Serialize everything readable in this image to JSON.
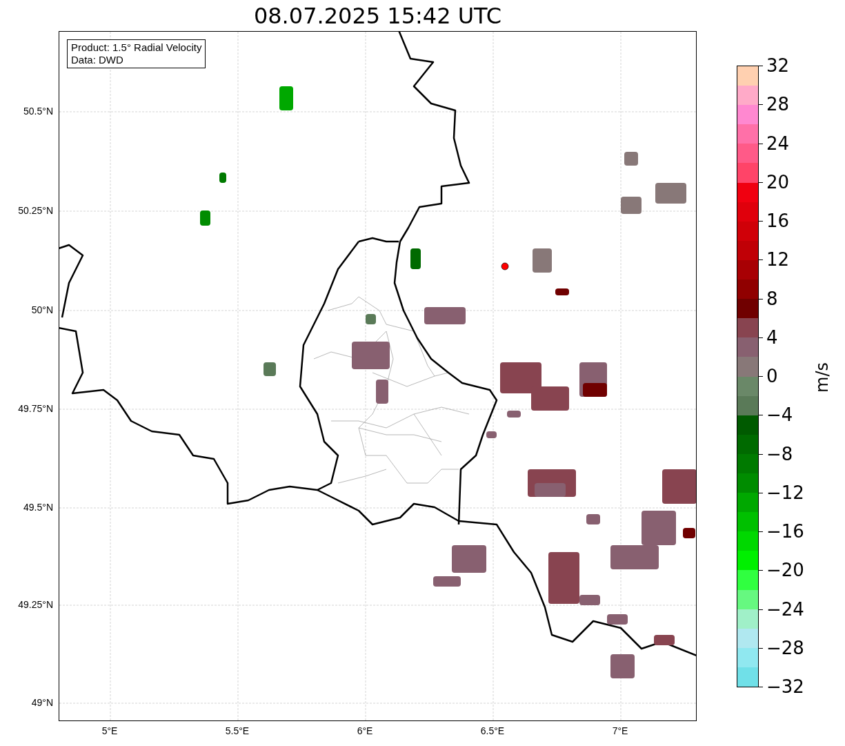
{
  "title": "08.07.2025 15:42 UTC",
  "map": {
    "info_box": [
      "Product: 1.5° Radial Velocity",
      "Data: DWD"
    ],
    "lat_ticks": [
      "50.5°N",
      "50.25°N",
      "50°N",
      "49.75°N",
      "49.5°N",
      "49.25°N",
      "49°N"
    ],
    "lon_ticks": [
      "5°E",
      "5.5°E",
      "6°E",
      "6.5°E",
      "7°E"
    ]
  },
  "colorbar": {
    "label": "m/s",
    "ticks": [
      "32",
      "28",
      "24",
      "20",
      "16",
      "12",
      "8",
      "4",
      "0",
      "−4",
      "−8",
      "−12",
      "−16",
      "−20",
      "−24",
      "−28",
      "−32"
    ],
    "segments": [
      {
        "color": "#ffd0b0"
      },
      {
        "color": "#ffaac8"
      },
      {
        "color": "#ff88d0"
      },
      {
        "color": "#ff70a8"
      },
      {
        "color": "#ff5a88"
      },
      {
        "color": "#ff4468"
      },
      {
        "color": "#f00010"
      },
      {
        "color": "#e0000c"
      },
      {
        "color": "#d00008"
      },
      {
        "color": "#c00006"
      },
      {
        "color": "#a80004"
      },
      {
        "color": "#900000"
      },
      {
        "color": "#700000"
      },
      {
        "color": "#884450"
      },
      {
        "color": "#886070"
      },
      {
        "color": "#887878"
      },
      {
        "color": "#6a8868"
      },
      {
        "color": "#5a7a58"
      },
      {
        "color": "#005a00"
      },
      {
        "color": "#006a00"
      },
      {
        "color": "#007a00"
      },
      {
        "color": "#008c00"
      },
      {
        "color": "#00a800"
      },
      {
        "color": "#00c000"
      },
      {
        "color": "#00d800"
      },
      {
        "color": "#00f000"
      },
      {
        "color": "#30ff40"
      },
      {
        "color": "#66f880"
      },
      {
        "color": "#a0f0c8"
      },
      {
        "color": "#b0e8f0"
      },
      {
        "color": "#90e8f0"
      },
      {
        "color": "#70e0e8"
      }
    ]
  }
}
